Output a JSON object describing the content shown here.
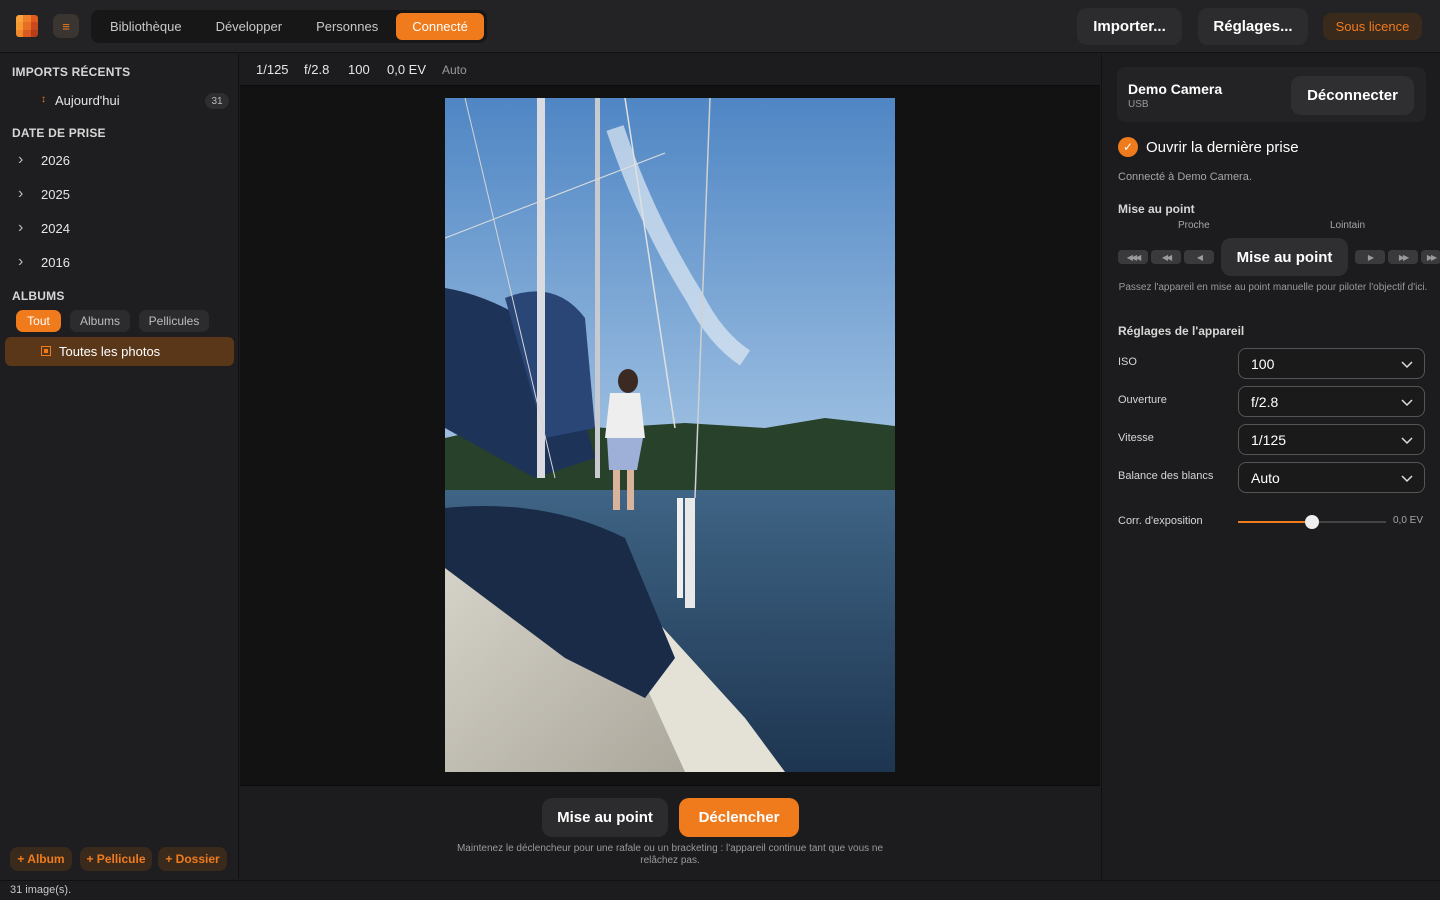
{
  "topbar": {
    "nav_tabs": [
      "Bibliothèque",
      "Développer",
      "Personnes",
      "Connecté"
    ],
    "active_tab": "Connecté",
    "import_label": "Importer...",
    "settings_label": "Réglages...",
    "license_label": "Sous licence"
  },
  "sidebar": {
    "recent_title": "IMPORTS RÉCENTS",
    "recent_item": {
      "label": "Aujourd'hui",
      "count": "31"
    },
    "date_title": "DATE DE PRISE",
    "years": [
      "2026",
      "2025",
      "2024",
      "2016"
    ],
    "albums_title": "ALBUMS",
    "album_filters": [
      "Tout",
      "Albums",
      "Pellicules"
    ],
    "selected_album": "Toutes les photos",
    "add_album": "+ Album",
    "add_roll": "+ Pellicule",
    "add_folder": "+ Dossier"
  },
  "infobar": {
    "shutter": "1/125",
    "aperture": "f/2.8",
    "iso": "100",
    "ev": "0,0 EV",
    "wb": "Auto"
  },
  "capture": {
    "focus_label": "Mise au point",
    "shutter_label": "Déclencher",
    "hint": "Maintenez le déclencheur pour une rafale ou un bracketing : l'appareil continue tant que vous ne relâchez pas."
  },
  "camera": {
    "name": "Demo Camera",
    "connection": "USB",
    "disconnect_label": "Déconnecter",
    "open_last_label": "Ouvrir la dernière prise",
    "status": "Connecté à Demo Camera.",
    "focus_title": "Mise au point",
    "near_label": "Proche",
    "far_label": "Lointain",
    "focus_button": "Mise au point",
    "focus_hint": "Passez l'appareil en mise au point manuelle pour piloter l'objectif d'ici.",
    "settings_title": "Réglages de l'appareil",
    "settings": [
      {
        "label": "ISO",
        "value": "100"
      },
      {
        "label": "Ouverture",
        "value": "f/2.8"
      },
      {
        "label": "Vitesse",
        "value": "1/125"
      },
      {
        "label": "Balance des blancs",
        "value": "Auto"
      }
    ],
    "exposure_label": "Corr. d'exposition",
    "exposure_value": "0,0 EV",
    "exposure_fraction": 0.5
  },
  "statusbar": {
    "text": "31 image(s)."
  },
  "colors": {
    "accent": "#f07b1c",
    "background": "#1c1c1e",
    "photo_viewer": "#121213"
  }
}
